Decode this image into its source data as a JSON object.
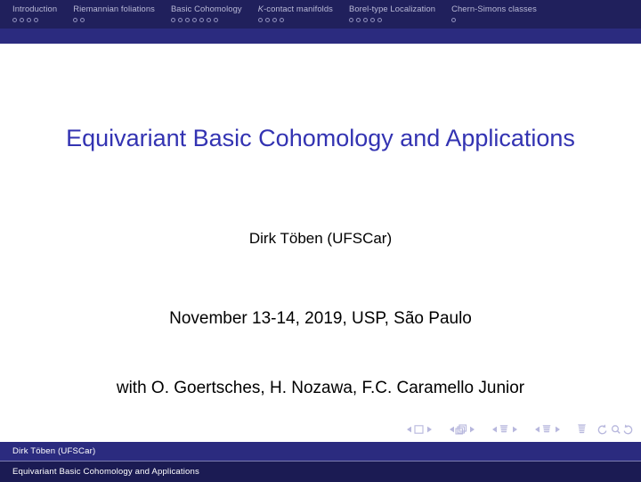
{
  "colors": {
    "nav_bar_dark": "#20205c",
    "nav_band": "#2b2b7f",
    "footer_upper": "#2b2b7f",
    "footer_lower": "#1b1b53",
    "title_blue": "#3333b2",
    "nav_label": "#b9b9d6",
    "body_background": "#ffffff",
    "body_text": "#000000"
  },
  "headline": {
    "sections": [
      {
        "label": "Introduction",
        "italic_prefix": "",
        "slides": 4
      },
      {
        "label": "Riemannian foliations",
        "italic_prefix": "",
        "slides": 2
      },
      {
        "label": "Basic Cohomology",
        "italic_prefix": "",
        "slides": 7
      },
      {
        "label": "-contact manifolds",
        "italic_prefix": "K",
        "slides": 4
      },
      {
        "label": "Borel-type Localization",
        "italic_prefix": "",
        "slides": 5
      },
      {
        "label": "Chern-Simons classes",
        "italic_prefix": "",
        "slides": 1
      }
    ]
  },
  "slide": {
    "title": "Equivariant Basic Cohomology and Applications",
    "author": "Dirk Töben (UFSCar)",
    "date": "November 13-14, 2019, USP, São Paulo",
    "collaborators": "with O. Goertsches, H. Nozawa, F.C. Caramello Junior"
  },
  "navigation_symbols": [
    {
      "name": "slide-navigation",
      "icon": "square"
    },
    {
      "name": "frame-navigation",
      "icon": "stacked-squares"
    },
    {
      "name": "subsection-navigation",
      "icon": "lines-small"
    },
    {
      "name": "section-navigation",
      "icon": "lines-small"
    },
    {
      "name": "document-navigation",
      "icon": "lines-stack"
    },
    {
      "name": "back-search-forward",
      "icon": "back-search-forward"
    }
  ],
  "footer": {
    "author_line": "Dirk Töben (UFSCar)",
    "title_line": "Equivariant Basic Cohomology and Applications"
  }
}
